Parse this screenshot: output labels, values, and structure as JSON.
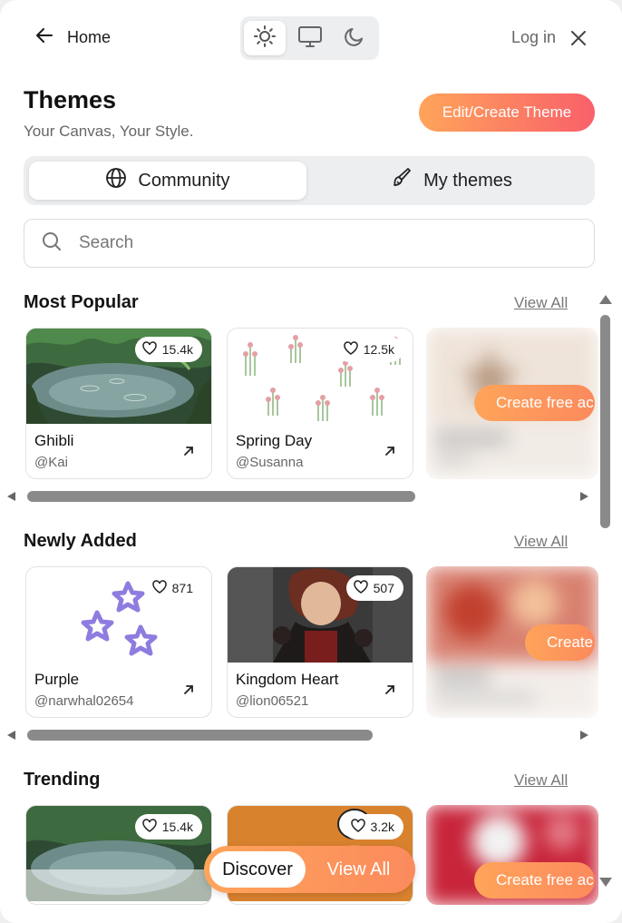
{
  "header": {
    "home_label": "Home",
    "login_label": "Log in",
    "theme_modes": [
      "light",
      "system",
      "dark"
    ],
    "active_mode": "light"
  },
  "page": {
    "title": "Themes",
    "subtitle": "Your Canvas, Your Style.",
    "edit_button": "Edit/Create Theme"
  },
  "tabs": [
    {
      "label": "Community",
      "icon": "globe-icon",
      "active": true
    },
    {
      "label": "My themes",
      "icon": "paintbrush-icon",
      "active": false
    }
  ],
  "search": {
    "placeholder": "Search",
    "value": ""
  },
  "sections": [
    {
      "title": "Most Popular",
      "view_all": "View All",
      "cards": [
        {
          "name": "Ghibli",
          "author": "@Kai",
          "likes": "15.4k"
        },
        {
          "name": "Spring Day",
          "author": "@Susanna",
          "likes": "12.5k"
        }
      ],
      "promo": "Create free ac"
    },
    {
      "title": "Newly Added",
      "view_all": "View All",
      "cards": [
        {
          "name": "Purple",
          "author": "@narwhal02654",
          "likes": "871"
        },
        {
          "name": "Kingdom Heart",
          "author": "@lion06521",
          "likes": "507"
        }
      ],
      "promo": "Create"
    },
    {
      "title": "Trending",
      "view_all": "View All",
      "cards": [
        {
          "name": "",
          "author": "",
          "likes": "15.4k"
        },
        {
          "name": "",
          "author": "",
          "likes": "3.2k"
        }
      ],
      "promo": "Create free ac"
    }
  ],
  "bottom_bar": {
    "discover": "Discover",
    "view_all": "View All"
  },
  "colors": {
    "accent_start": "#ffa45a",
    "accent_end": "#f9606a"
  }
}
